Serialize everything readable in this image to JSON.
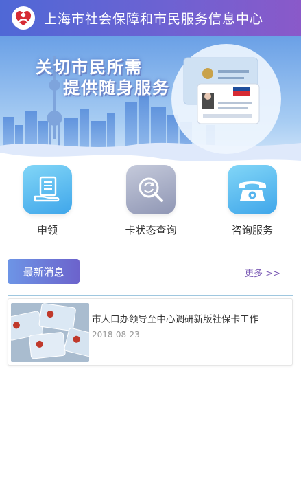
{
  "header": {
    "title": "上海市社会保障和市民服务信息中心",
    "logo_icon": "heart-person-logo-icon",
    "gradient": [
      "#4f68d6",
      "#8a59c9"
    ]
  },
  "banner": {
    "slogan_line1": "关切市民所需",
    "slogan_line2": "提供随身服务",
    "image": "shanghai-skyline-social-security-card"
  },
  "actions": [
    {
      "label": "申领",
      "icon": "application-form-hand-icon"
    },
    {
      "label": "卡状态查询",
      "icon": "magnifier-refresh-icon"
    },
    {
      "label": "咨询服务",
      "icon": "telephone-icon"
    }
  ],
  "news": {
    "section_label": "最新消息",
    "more_label": "更多 >>",
    "items": [
      {
        "title": "市人口办领导至中心调研新版社保卡工作",
        "date": "2018-08-23",
        "thumb_icon": "social-security-cards-photo"
      }
    ]
  },
  "colors": {
    "accent_blue": "#3fa6ea",
    "accent_purple": "#6c63cc",
    "more_link": "#7b5bb5"
  }
}
